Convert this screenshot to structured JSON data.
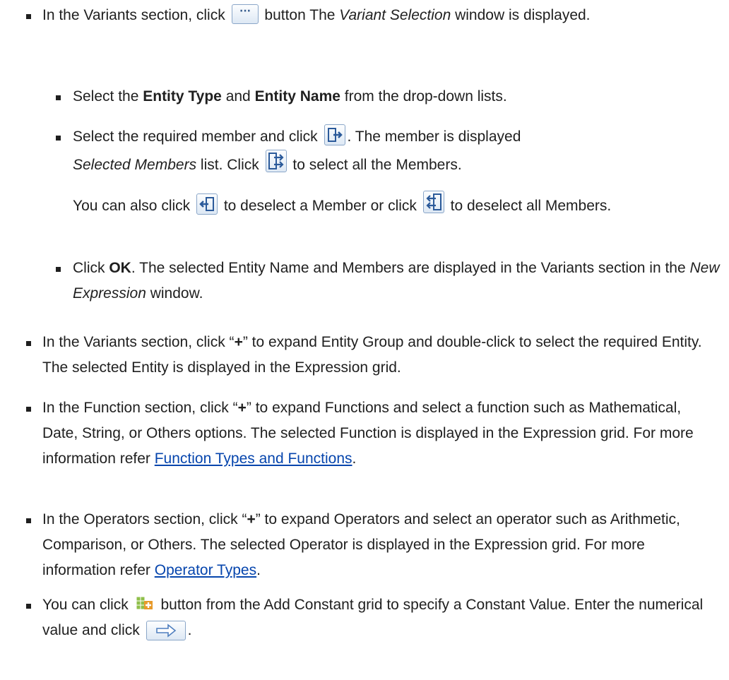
{
  "items": [
    {
      "a": "In the Variants section, click ",
      "b": " button The ",
      "c": "Variant Selection",
      "d": " window is displayed."
    },
    {
      "a": "Select the ",
      "b": "Entity Type",
      "c": " and ",
      "d": "Entity Name",
      "e": " from the drop-down lists."
    },
    {
      "a": "Select the required member and click ",
      "b": ". The member is displayed",
      "c": "Selected Members",
      "d": " list. Click ",
      "e": " to select all the Members."
    },
    {
      "a": "You can also click ",
      "b": " to deselect a Member or click ",
      "c": " to deselect all Members."
    },
    {
      "a": "Click ",
      "b": "OK",
      "c": ". The selected Entity Name and Members are displayed in the Variants section in the ",
      "d": "New Expression",
      "e": " window."
    },
    {
      "a": "In the Variants section, click “",
      "b": "+",
      "c": "” to expand Entity Group and double-click to select the required Entity. The selected Entity is displayed in the Expression grid."
    },
    {
      "a": "In the Function section, click “",
      "b": "+",
      "c": "” to expand Functions and select a function such as Mathematical, Date, String, or Others options. The selected Function is displayed in the Expression grid. For more information refer ",
      "link": "Function Types and Functions",
      "d": "."
    },
    {
      "a": "In the Operators section, click “",
      "b": "+",
      "c": "” to expand Operators and select an operator such as Arithmetic, Comparison, or Others. The selected Operator is displayed in the Expression grid. For more information refer ",
      "link": "Operator Types",
      "d": "."
    },
    {
      "a": "You can click ",
      "b": " button from the Add Constant grid to specify a Constant Value. Enter the numerical value and click ",
      "c": "."
    }
  ],
  "icons": {
    "ellipsis": "ellipsis-button-icon",
    "move_right": "move-right-icon",
    "move_all_right": "move-all-right-icon",
    "move_left": "move-left-icon",
    "move_all_left": "move-all-left-icon",
    "add_constant": "add-constant-grid-icon",
    "arrow_right": "arrow-right-button-icon"
  },
  "colors": {
    "link": "#0645ad",
    "text": "#1f1f1f",
    "icon_accent": "#3a7fc8"
  }
}
